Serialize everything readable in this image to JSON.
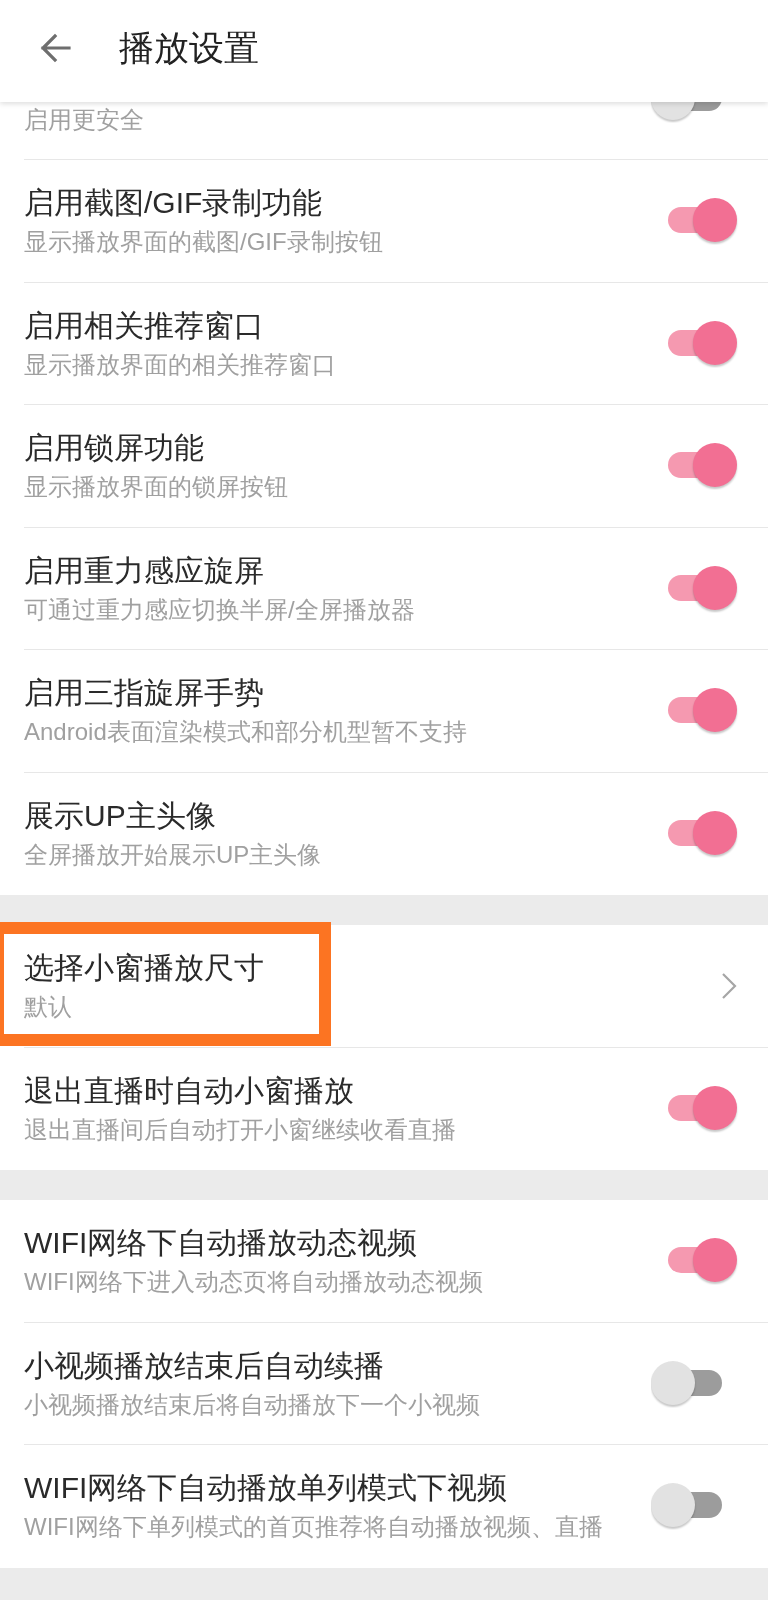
{
  "header": {
    "title": "播放设置"
  },
  "sections": [
    {
      "items": [
        {
          "kind": "toggle",
          "summary": "启用更安全",
          "on": false,
          "highlighted": false
        },
        {
          "kind": "toggle",
          "title": "启用截图/GIF录制功能",
          "summary": "显示播放界面的截图/GIF录制按钮",
          "on": true,
          "highlighted": false
        },
        {
          "kind": "toggle",
          "title": "启用相关推荐窗口",
          "summary": "显示播放界面的相关推荐窗口",
          "on": true,
          "highlighted": false
        },
        {
          "kind": "toggle",
          "title": "启用锁屏功能",
          "summary": "显示播放界面的锁屏按钮",
          "on": true,
          "highlighted": false
        },
        {
          "kind": "toggle",
          "title": "启用重力感应旋屏",
          "summary": "可通过重力感应切换半屏/全屏播放器",
          "on": true,
          "highlighted": false
        },
        {
          "kind": "toggle",
          "title": "启用三指旋屏手势",
          "summary": "Android表面渲染模式和部分机型暂不支持",
          "on": true,
          "highlighted": false
        },
        {
          "kind": "toggle",
          "title": "展示UP主头像",
          "summary": "全屏播放开始展示UP主头像",
          "on": true,
          "highlighted": false
        }
      ]
    },
    {
      "items": [
        {
          "kind": "link",
          "title": "选择小窗播放尺寸",
          "summary": "默认",
          "highlighted": true
        },
        {
          "kind": "toggle",
          "title": "退出直播时自动小窗播放",
          "summary": "退出直播间后自动打开小窗继续收看直播",
          "on": true,
          "highlighted": false
        }
      ]
    },
    {
      "items": [
        {
          "kind": "toggle",
          "title": "WIFI网络下自动播放动态视频",
          "summary": "WIFI网络下进入动态页将自动播放动态视频",
          "on": true,
          "highlighted": false
        },
        {
          "kind": "toggle",
          "title": "小视频播放结束后自动续播",
          "summary": "小视频播放结束后将自动播放下一个小视频",
          "on": false,
          "highlighted": false
        },
        {
          "kind": "toggle",
          "title": "WIFI网络下自动播放单列模式下视频",
          "summary": "WIFI网络下单列模式的首页推荐将自动播放视频、直播",
          "on": false,
          "highlighted": false
        }
      ]
    }
  ]
}
